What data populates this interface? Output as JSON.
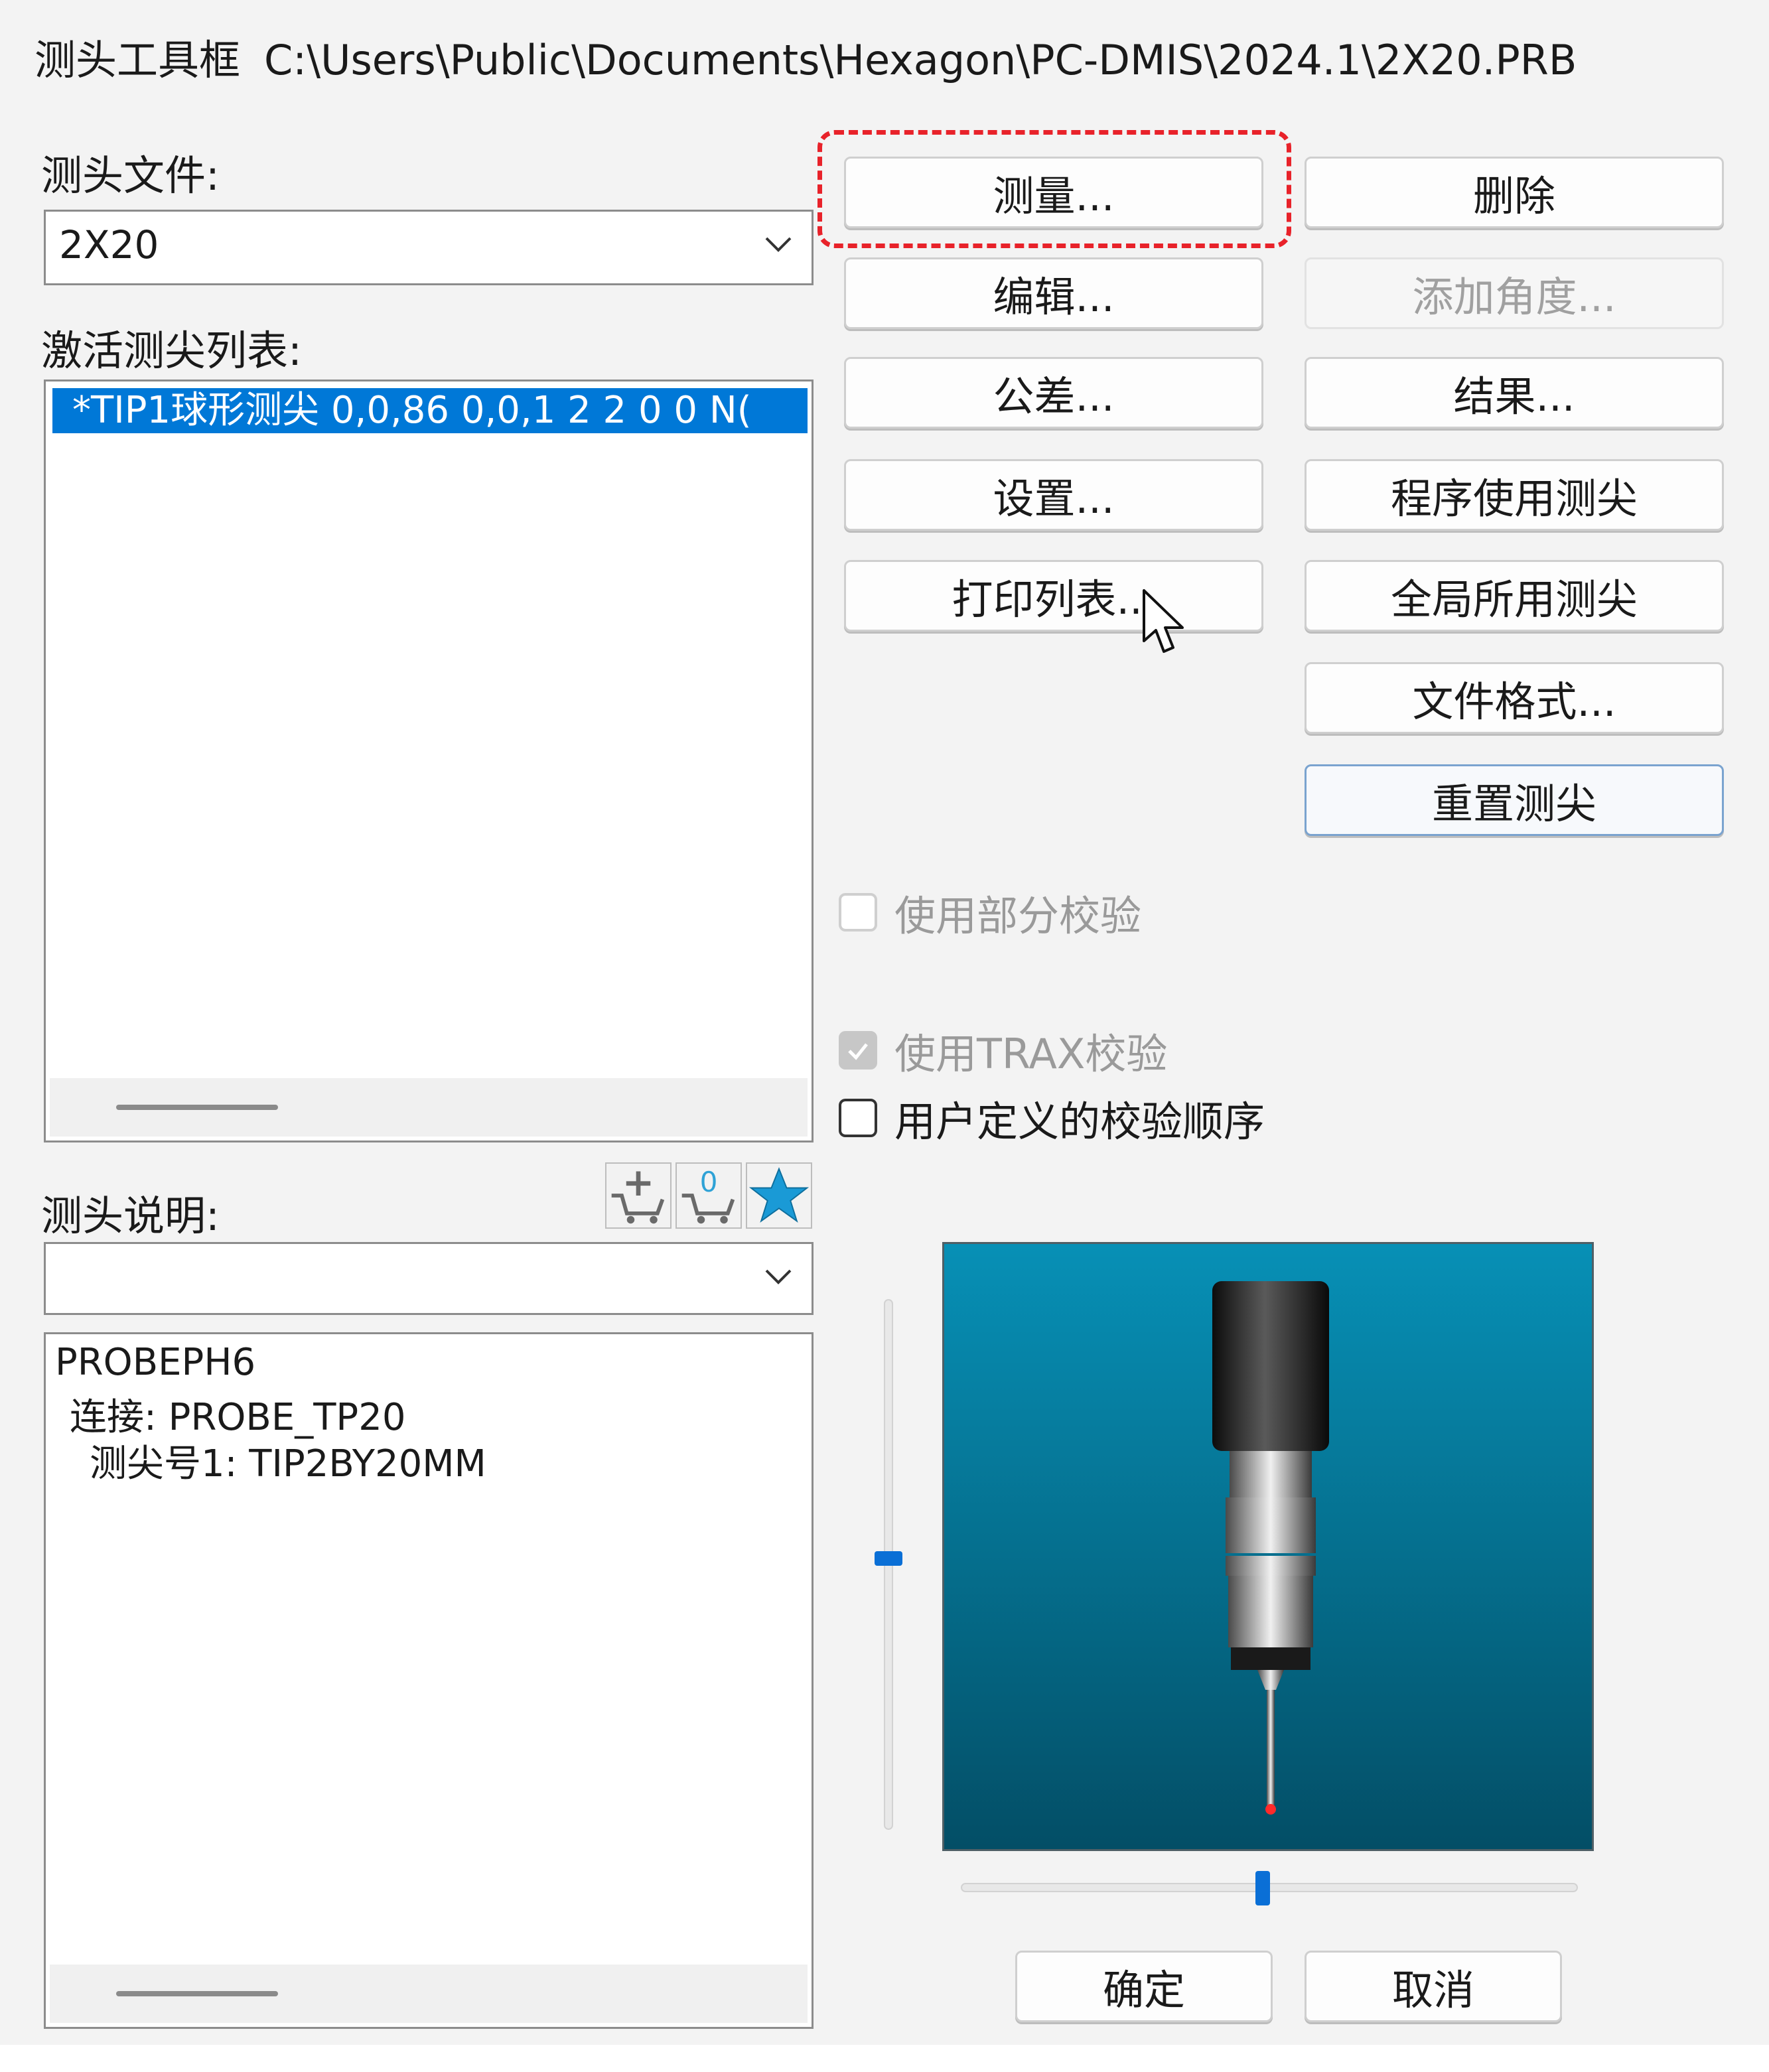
{
  "window": {
    "title": "测头工具框",
    "path": "C:\\Users\\Public\\Documents\\Hexagon\\PC-DMIS\\2024.1\\2X20.PRB"
  },
  "probe_file": {
    "label": "测头文件:",
    "value": "2X20"
  },
  "active_tips": {
    "label": "激活测尖列表:",
    "items": [
      "*TIP1球形测尖  0,0,86 0,0,1 2  2  0  0  N("
    ]
  },
  "probe_desc": {
    "label": "测头说明:",
    "combo_value": "",
    "tree": [
      "PROBEPH6",
      "连接: PROBE_TP20",
      "测尖号1: TIP2BY20MM"
    ]
  },
  "buttons": {
    "measure": "测量...",
    "delete": "删除",
    "edit": "编辑...",
    "add_angle": "添加角度...",
    "tolerance": "公差...",
    "results": "结果...",
    "setup": "设置...",
    "program_tips": "程序使用测尖",
    "print_list": "打印列表...",
    "global_tips": "全局所用测尖",
    "file_format": "文件格式...",
    "reset_tips": "重置测尖",
    "ok": "确定",
    "cancel": "取消"
  },
  "checkboxes": {
    "partial": {
      "label": "使用部分校验",
      "checked": false,
      "enabled": false
    },
    "trax": {
      "label": "使用TRAX校验",
      "checked": true,
      "enabled": false
    },
    "user_order": {
      "label": "用户定义的校验顺序",
      "checked": false,
      "enabled": true
    }
  },
  "icons": {
    "chevron": "chevron-down-icon",
    "add_component": "add-component-icon",
    "zero_component": "zero-component-icon",
    "favorite": "star-icon",
    "cursor": "mouse-cursor-icon"
  },
  "colors": {
    "selection": "#0078d7",
    "focus_ring": "#e8222a",
    "slider": "#0a6fd6",
    "preview_top": "#0790b6",
    "preview_bottom": "#034e66"
  }
}
